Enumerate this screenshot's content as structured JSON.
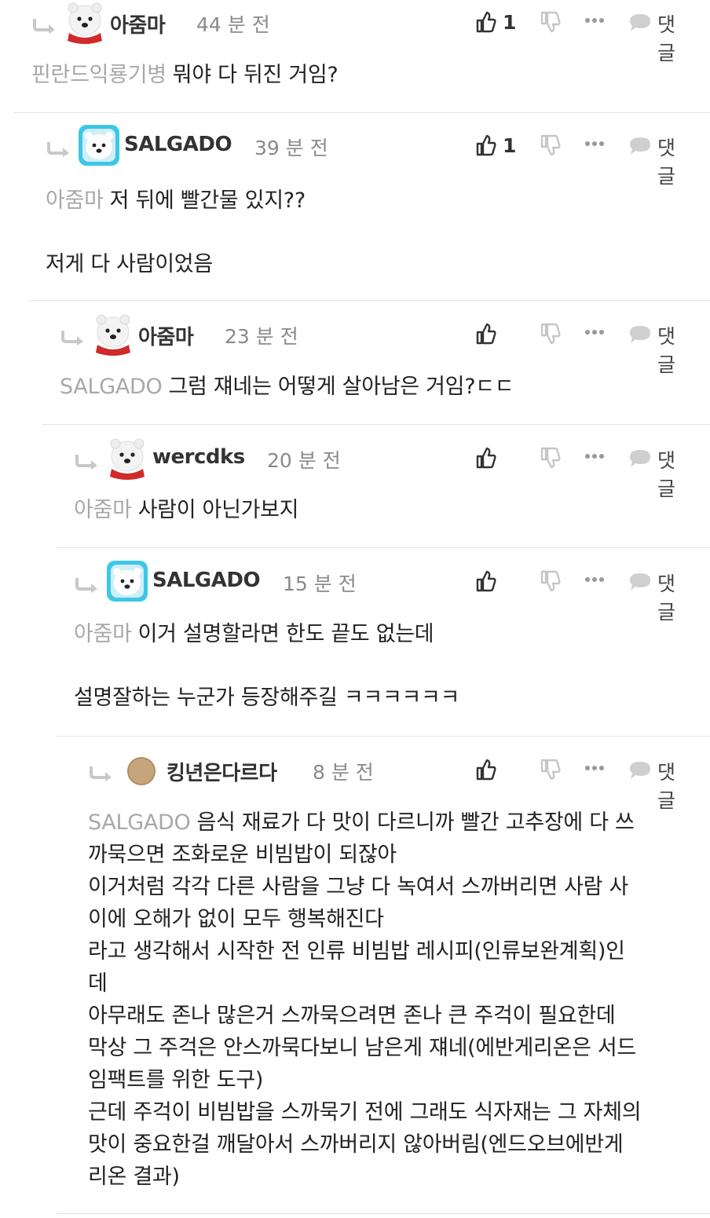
{
  "ui": {
    "reply_label": "댓글"
  },
  "comments": [
    {
      "nickname": "아줌마",
      "time": "44 분 전",
      "likes": "1",
      "avatar": "polar-bear-red-scarf",
      "mention": "핀란드익룡기병",
      "lines": [
        "뭐야 다 뒤진 거임?"
      ]
    },
    {
      "nickname": "SALGADO",
      "time": "39 분 전",
      "likes": "1",
      "avatar": "polar-bear-blue-frame",
      "mention": "아줌마",
      "lines": [
        "저 뒤에 빨간물 있지??",
        "",
        "저게 다 사람이었음"
      ]
    },
    {
      "nickname": "아줌마",
      "time": "23 분 전",
      "likes": "",
      "avatar": "polar-bear-red-scarf",
      "mention": "SALGADO",
      "lines": [
        "그럼 쟤네는 어떻게 살아남은 거임?ㄷㄷ"
      ]
    },
    {
      "nickname": "wercdks",
      "time": "20 분 전",
      "likes": "",
      "avatar": "polar-bear-red-scarf",
      "mention": "아줌마",
      "lines": [
        "사람이 아닌가보지"
      ]
    },
    {
      "nickname": "SALGADO",
      "time": "15 분 전",
      "likes": "",
      "avatar": "polar-bear-blue-frame",
      "mention": "아줌마",
      "lines": [
        "이거 설명할라면 한도 끝도 없는데",
        "",
        "설명잘하는 누군가 등장해주길 ㅋㅋㅋㅋㅋㅋ"
      ]
    },
    {
      "nickname": "킹년은다르다",
      "time": "8 분 전",
      "likes": "",
      "avatar": "tan-circle",
      "mention": "SALGADO",
      "lines": [
        "음식 재료가 다 맛이 다르니까 빨간 고추장에 다 쓰",
        "까묵으면 조화로운 비빔밥이 되잖아",
        "이거처럼 각각 다른 사람을 그냥 다 녹여서 스까버리면 사람 사",
        "이에 오해가 없이 모두 행복해진다",
        "라고 생각해서 시작한 전 인류 비빔밥 레시피(인류보완계획)인",
        "데",
        "아무래도 존나 많은거 스까묵으려면 존나 큰 주걱이 필요한데",
        "막상 그 주걱은 안스까묵다보니 남은게 쟤네(에반게리온은 서드",
        "임팩트를 위한 도구)",
        "근데 주걱이 비빔밥을 스까묵기 전에 그래도 식자재는 그 자체의",
        "맛이 중요한걸 깨달아서 스까버리지 않아버림(엔드오브에반게",
        "리온 결과)"
      ]
    }
  ]
}
